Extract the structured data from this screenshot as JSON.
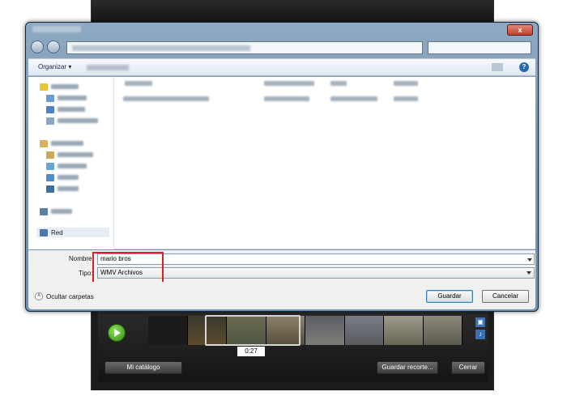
{
  "dialog": {
    "title": "Guardar como",
    "close_glyph": "x",
    "help_glyph": "?"
  },
  "toolbar": {
    "organize_label": "Organizar ▾"
  },
  "sidebar": {
    "items": [
      {
        "label": "Red",
        "icon": "network-icon"
      }
    ]
  },
  "form": {
    "name_label": "Nombre:",
    "name_value": "mario bros",
    "type_label": "Tipo:",
    "type_value": "WMV Archivos"
  },
  "footer": {
    "hide_folders_label": "Ocultar carpetas",
    "save_label": "Guardar",
    "cancel_label": "Cancelar"
  },
  "editor": {
    "time_label": "0:27",
    "catalog_label": "Mi catálogo",
    "save_clip_label": "Guardar recorte...",
    "close_label": "Cerrar"
  },
  "colors": {
    "highlight_box": "#d81f26",
    "dialog_frame": "#7c98b5",
    "play_green": "#2d8f12"
  }
}
